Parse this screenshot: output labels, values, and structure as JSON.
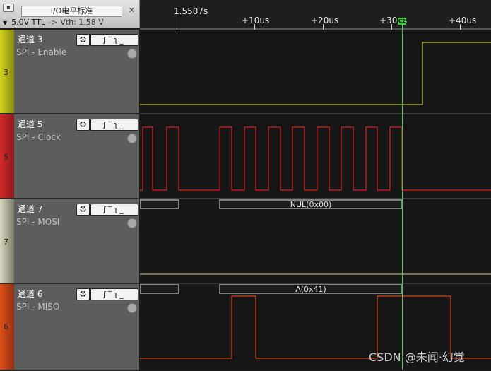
{
  "header": {
    "title": "I/O电平标准",
    "close_label": "▪",
    "x_label": "✕",
    "level": "5.0V TTL",
    "arrow": "->",
    "vth": "Vth: 1.58 V"
  },
  "ruler": {
    "base": "1.5507s",
    "ticks": [
      "+10us",
      "+20us",
      "+30us",
      "+40us"
    ]
  },
  "cursor": {
    "label": "C2"
  },
  "channels": [
    {
      "number": "3",
      "name": "通道 3",
      "sub": "SPI - Enable",
      "color": "#d2d21c"
    },
    {
      "number": "5",
      "name": "通道 5",
      "sub": "SPI - Clock",
      "color": "#d42a2a"
    },
    {
      "number": "7",
      "name": "通道 7",
      "sub": "SPI - MOSI",
      "color": "#c8c8b0"
    },
    {
      "number": "6",
      "name": "通道 6",
      "sub": "SPI - MISO",
      "color": "#e05018"
    }
  ],
  "icons": {
    "gear": "⚙",
    "edges": "ʃ‾ʅ_"
  },
  "decode": {
    "mosi": "NUL(0x00)",
    "miso": "A(0x41)"
  },
  "colors": {
    "enable": "#e6e638",
    "clock": "#ff2222",
    "mosi": "#cfcf88",
    "miso": "#ff4a1a",
    "cursor": "#3ccf3c"
  },
  "watermark": "CSDN @未闻·幻觉"
}
